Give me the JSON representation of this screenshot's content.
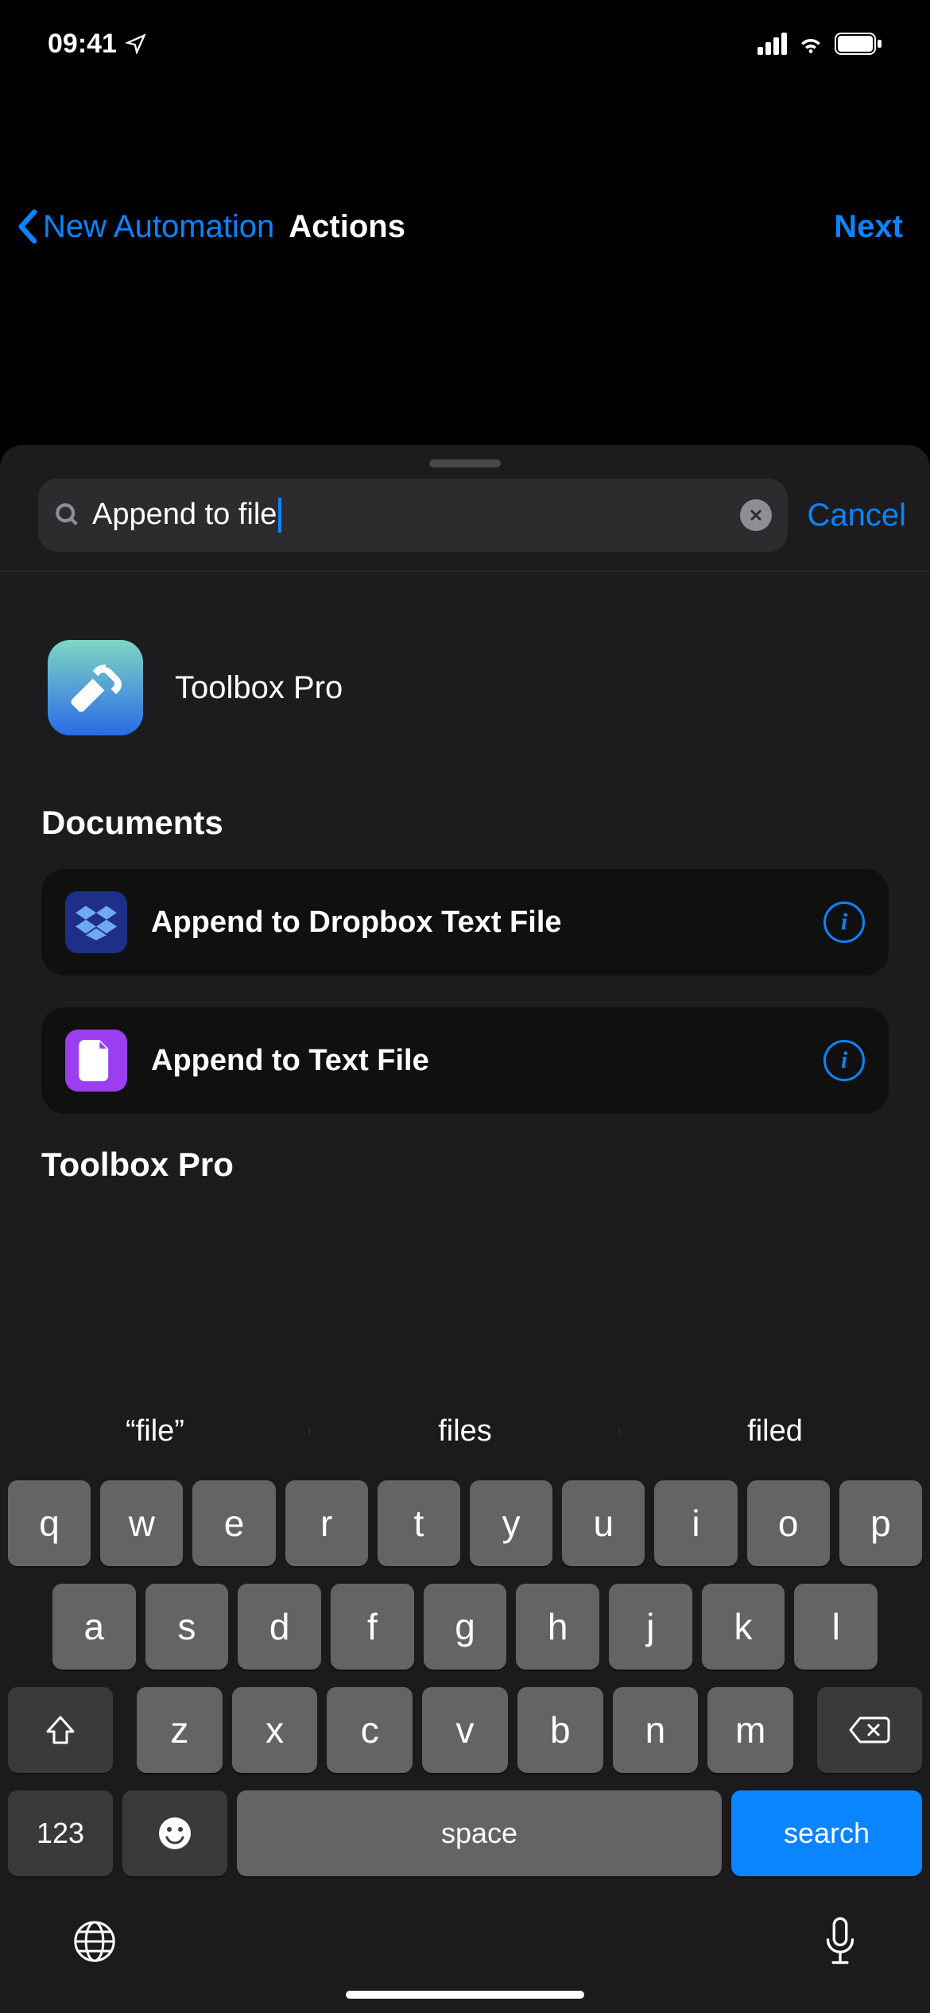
{
  "status": {
    "time": "09:41"
  },
  "nav": {
    "back": "New Automation",
    "title": "Actions",
    "next": "Next"
  },
  "search": {
    "value": "Append to file",
    "cancel": "Cancel"
  },
  "apps": {
    "toolbox": "Toolbox Pro"
  },
  "sections": {
    "documents": {
      "title": "Documents",
      "actions": [
        {
          "label": "Append to Dropbox Text File"
        },
        {
          "label": "Append to Text File"
        }
      ]
    },
    "toolbox": {
      "title": "Toolbox Pro"
    }
  },
  "keyboard": {
    "suggestions": [
      "“file”",
      "files",
      "filed"
    ],
    "row1": [
      "q",
      "w",
      "e",
      "r",
      "t",
      "y",
      "u",
      "i",
      "o",
      "p"
    ],
    "row2": [
      "a",
      "s",
      "d",
      "f",
      "g",
      "h",
      "j",
      "k",
      "l"
    ],
    "row3": [
      "z",
      "x",
      "c",
      "v",
      "b",
      "n",
      "m"
    ],
    "numeric": "123",
    "space": "space",
    "search": "search"
  }
}
